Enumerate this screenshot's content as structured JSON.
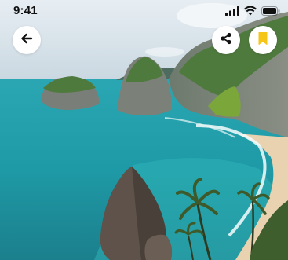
{
  "status_bar": {
    "time": "9:41",
    "icons": [
      "signal-bars-icon",
      "wifi-icon",
      "battery-icon"
    ]
  },
  "header": {
    "buttons": [
      {
        "name": "back",
        "icon": "arrow-left-icon"
      },
      {
        "name": "share",
        "icon": "share-icon"
      },
      {
        "name": "bookmark",
        "icon": "bookmark-icon"
      }
    ]
  },
  "hero_image": {
    "description_icon": "coastal-landscape-photo"
  },
  "colors": {
    "bookmark_accent": "#F5C518",
    "sky": "#DCE6EE",
    "sea": "#1B9FA8",
    "icon_dark": "#111111"
  }
}
